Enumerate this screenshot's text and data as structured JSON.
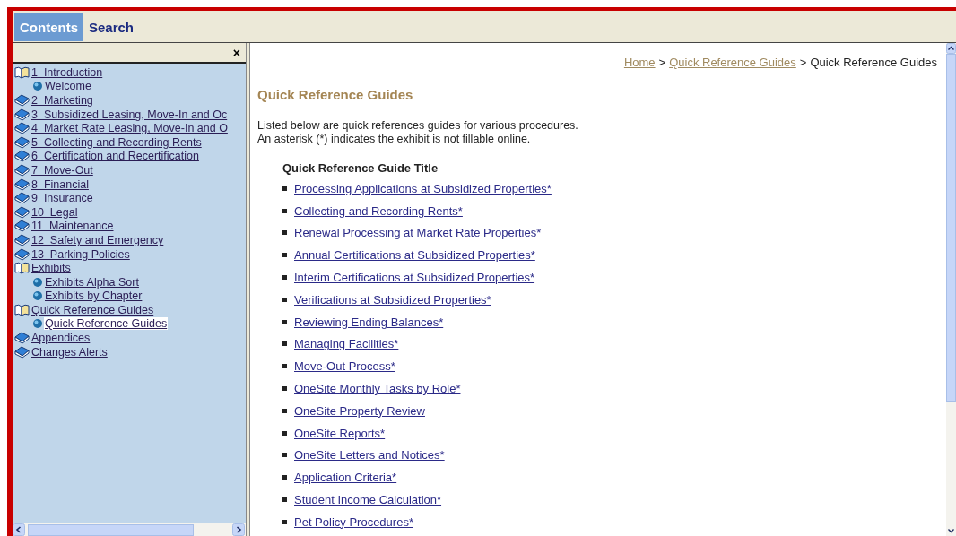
{
  "tabs": [
    {
      "label": "Contents",
      "selected": true
    },
    {
      "label": "Search",
      "selected": false
    }
  ],
  "sidebar": {
    "close": "×",
    "tree": [
      {
        "kind": "book-open",
        "label": "1  Introduction",
        "children": [
          {
            "kind": "page",
            "label": "Welcome",
            "selected": false
          }
        ]
      },
      {
        "kind": "book",
        "label": "2  Marketing"
      },
      {
        "kind": "book",
        "label": "3  Subsidized Leasing, Move-In and Oc"
      },
      {
        "kind": "book",
        "label": "4  Market Rate Leasing, Move-In and O"
      },
      {
        "kind": "book",
        "label": "5  Collecting and Recording Rents"
      },
      {
        "kind": "book",
        "label": "6  Certification and Recertification"
      },
      {
        "kind": "book",
        "label": "7  Move-Out"
      },
      {
        "kind": "book",
        "label": "8  Financial"
      },
      {
        "kind": "book",
        "label": "9  Insurance"
      },
      {
        "kind": "book",
        "label": "10  Legal"
      },
      {
        "kind": "book",
        "label": "11  Maintenance"
      },
      {
        "kind": "book",
        "label": "12  Safety and Emergency"
      },
      {
        "kind": "book",
        "label": "13  Parking Policies"
      },
      {
        "kind": "book-open",
        "label": "Exhibits",
        "children": [
          {
            "kind": "page",
            "label": "Exhibits Alpha Sort",
            "selected": false
          },
          {
            "kind": "page",
            "label": "Exhibits by Chapter",
            "selected": false
          }
        ]
      },
      {
        "kind": "book-open",
        "label": "Quick Reference Guides",
        "children": [
          {
            "kind": "page",
            "label": "Quick Reference Guides",
            "selected": true
          }
        ]
      },
      {
        "kind": "book",
        "label": "Appendices"
      },
      {
        "kind": "book",
        "label": "Changes Alerts"
      }
    ]
  },
  "content": {
    "breadcrumb": [
      {
        "label": "Home",
        "link": true
      },
      {
        "label": ">",
        "link": false
      },
      {
        "label": "Quick Reference Guides",
        "link": true
      },
      {
        "label": ">",
        "link": false
      },
      {
        "label": "Quick Reference Guides",
        "link": false
      }
    ],
    "heading": "Quick Reference Guides",
    "intro": [
      "Listed below are quick references guides for various procedures.",
      "An asterisk (*) indicates the exhibit is not fillable online."
    ],
    "list_title": "Quick Reference Guide Title",
    "links": [
      "Processing Applications at Subsidized Properties*",
      "Collecting and Recording Rents*",
      "Renewal Processing at Market Rate Properties*",
      "Annual Certifications at Subsidized Properties*",
      "Interim Certifications at Subsidized Properties*",
      "Verifications at Subsidized Properties*",
      "Reviewing Ending Balances*",
      "Managing Facilities*",
      "Move-Out Process*",
      "OneSite Monthly Tasks by Role*",
      "OneSite Property Review",
      "OneSite Reports*",
      "OneSite Letters and Notices*",
      "Application Criteria*",
      "Student Income Calculation*",
      "Pet Policy Procedures*"
    ]
  }
}
